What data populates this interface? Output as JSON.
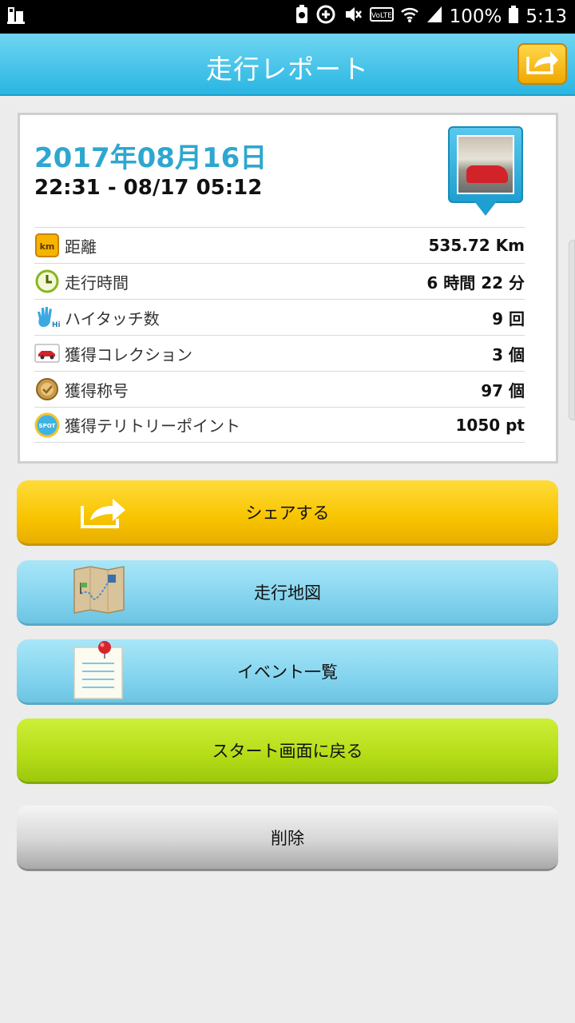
{
  "status_bar": {
    "battery_text": "100%",
    "time": "5:13",
    "network_label": "VoLTE"
  },
  "header": {
    "title": "走行レポート",
    "share_icon": "share-arrow-icon"
  },
  "report": {
    "date": "2017年08月16日",
    "time_range": "22:31 - 08/17 05:12",
    "thumbnail": "car-photo-thumbnail",
    "stats": [
      {
        "icon": "km-icon",
        "label": "距離",
        "value": "535.72 Km"
      },
      {
        "icon": "clock-icon",
        "label": "走行時間",
        "value": "6 時間 22 分"
      },
      {
        "icon": "hi-five-icon",
        "label": "ハイタッチ数",
        "value": "9 回"
      },
      {
        "icon": "car-collection-icon",
        "label": "獲得コレクション",
        "value": "3 個"
      },
      {
        "icon": "medal-icon",
        "label": "獲得称号",
        "value": "97 個"
      },
      {
        "icon": "spot-icon",
        "label": "獲得テリトリーポイント",
        "value": "1050 pt"
      }
    ]
  },
  "buttons": {
    "share": "シェアする",
    "map": "走行地図",
    "events": "イベント一覧",
    "back_to_start": "スタート画面に戻る",
    "delete": "削除"
  },
  "colors": {
    "header": "#29b6e2",
    "date_text": "#2ea7d0",
    "share_button": "#f8c400",
    "map_button": "#84d4ee",
    "start_button": "#b4dc16",
    "delete_button": "#d6d6d6"
  },
  "km_badge_text": "km",
  "spot_badge_text": "SPOT",
  "hi_badge_text": "Hi!"
}
